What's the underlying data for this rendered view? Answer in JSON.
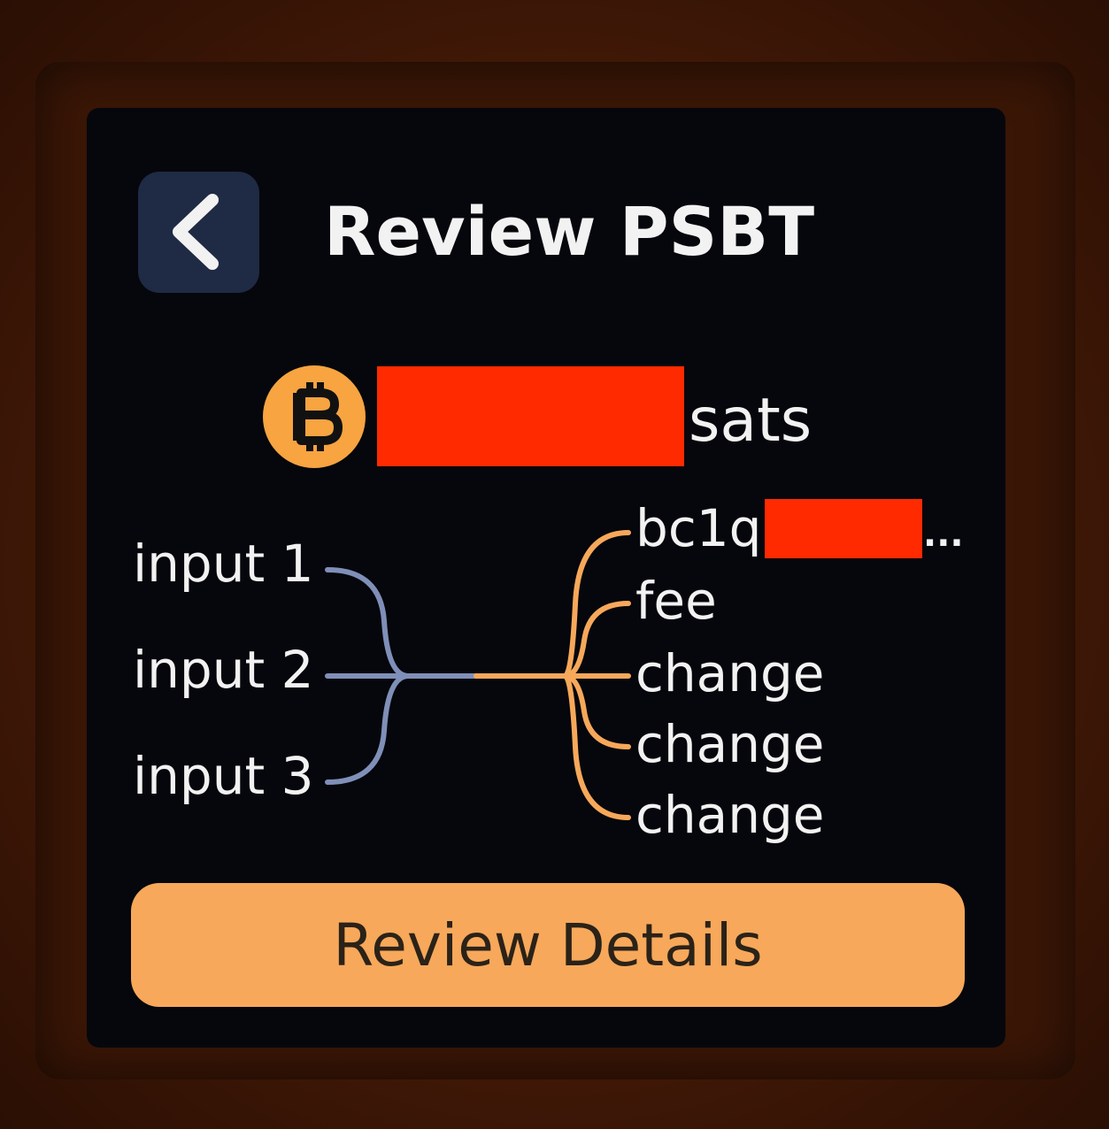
{
  "header": {
    "title": "Review PSBT",
    "back_icon": "chevron-left-icon"
  },
  "amount": {
    "icon": "bitcoin-icon",
    "value": "",
    "unit": "sats"
  },
  "flow": {
    "inputs": [
      "input 1",
      "input 2",
      "input 3"
    ],
    "outputs": [
      {
        "label": "bc1q",
        "suffix": "..."
      },
      {
        "label": "fee"
      },
      {
        "label": "change"
      },
      {
        "label": "change"
      },
      {
        "label": "change"
      }
    ]
  },
  "footer": {
    "review_button_label": "Review Details"
  },
  "colors": {
    "accent_orange": "#f7a85a",
    "input_line_blue": "#7f8fb8",
    "back_button_bg": "#1f2a44",
    "redaction": "#ff2a00",
    "screen_bg": "#06070c"
  }
}
